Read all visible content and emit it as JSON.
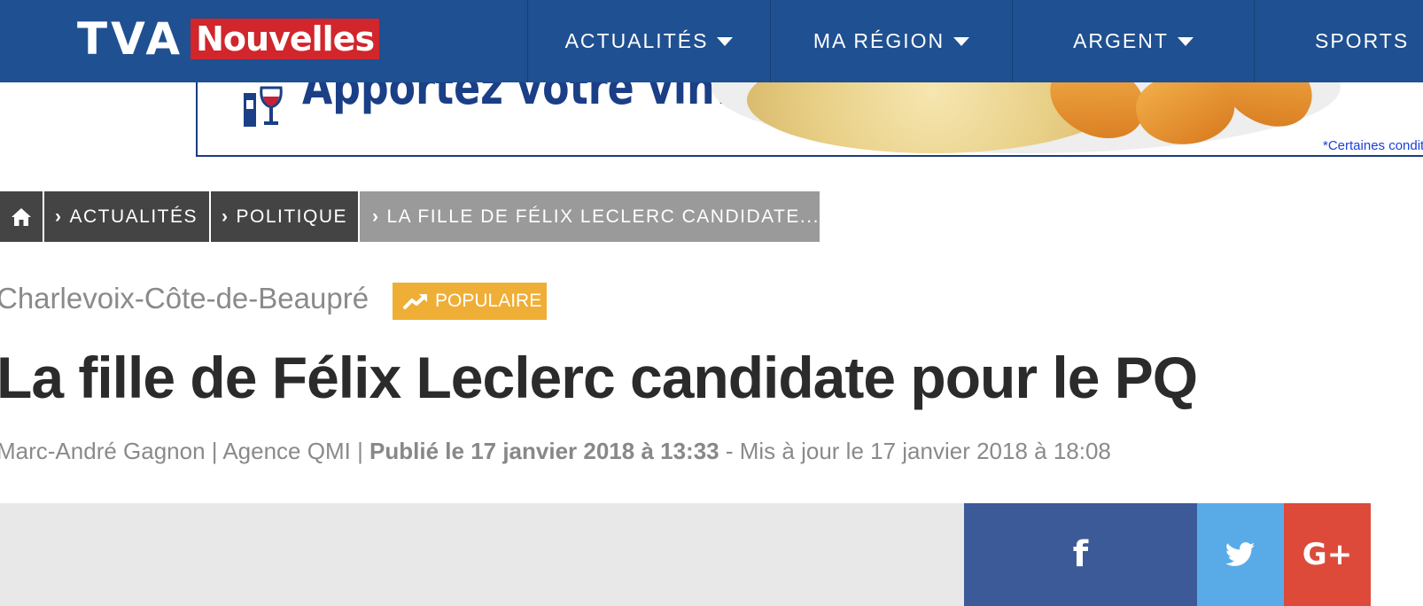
{
  "header": {
    "logo": {
      "brand": "TVA",
      "section": "Nouvelles"
    },
    "nav": [
      {
        "label": "ACTUALITÉS"
      },
      {
        "label": "MA RÉGION"
      },
      {
        "label": "ARGENT"
      },
      {
        "label": "SPORTS"
      }
    ]
  },
  "ad": {
    "headline": "Apportez votre vin!",
    "disclaimer": "*Certaines conditions s'appliquent"
  },
  "breadcrumb": {
    "home_icon": "home-icon",
    "items": [
      {
        "label": "ACTUALITÉS"
      },
      {
        "label": "POLITIQUE"
      },
      {
        "label": "LA FILLE DE FÉLIX LECLERC CANDIDATE..."
      }
    ]
  },
  "article": {
    "region": "Charlevoix-Côte-de-Beaupré",
    "badge": "POPULAIRE",
    "title": "La fille de Félix Leclerc candidate pour le PQ",
    "byline": {
      "author": "Marc-André Gagnon | Agence QMI | ",
      "published": "Publié le 17 janvier 2018 à 13:33",
      "updated": " - Mis à jour le 17 janvier 2018 à 18:08"
    }
  },
  "share": {
    "facebook_icon": "facebook-icon",
    "twitter_icon": "twitter-icon",
    "googleplus_icon": "google-plus-icon",
    "googleplus_glyph": "G+",
    "facebook_glyph": "f"
  },
  "colors": {
    "nav_bg": "#1f5091",
    "brand_red": "#d0262c",
    "badge": "#efae35",
    "facebook": "#3c5a98",
    "twitter": "#59abe8",
    "googleplus": "#dd4a3a"
  }
}
